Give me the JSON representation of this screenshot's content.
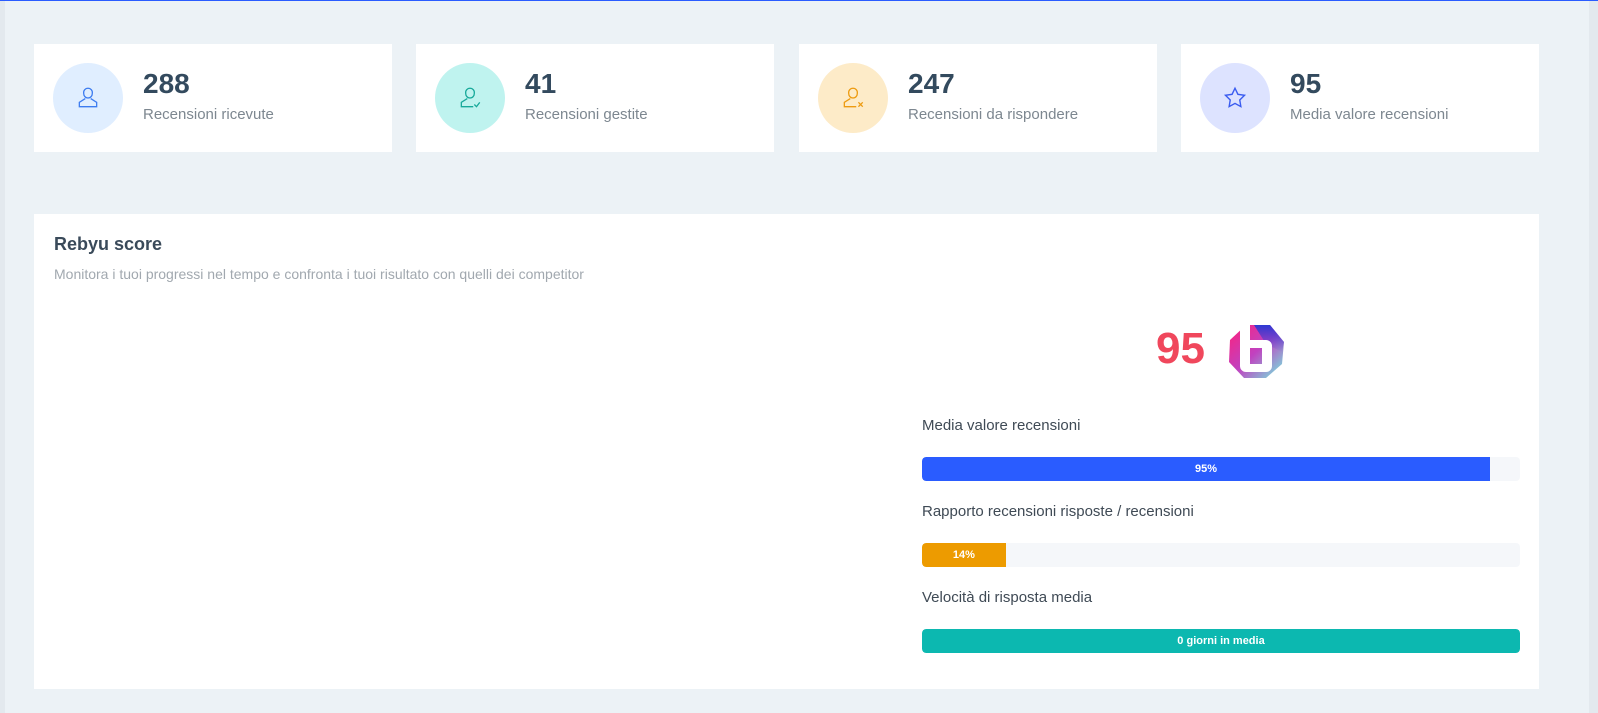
{
  "stats": [
    {
      "value": "288",
      "label": "Recensioni ricevute",
      "icon": "user-icon",
      "bg": "#e0eeff",
      "color": "#3d7cf0"
    },
    {
      "value": "41",
      "label": "Recensioni gestite",
      "icon": "user-check-icon",
      "bg": "#bff3ef",
      "color": "#17a99a"
    },
    {
      "value": "247",
      "label": "Recensioni da rispondere",
      "icon": "user-x-icon",
      "bg": "#fdebc8",
      "color": "#ed9b11"
    },
    {
      "value": "95",
      "label": "Media valore recensioni",
      "icon": "star-icon",
      "bg": "#dde3ff",
      "color": "#3a5cf0"
    }
  ],
  "panel": {
    "title": "Rebyu score",
    "subtitle": "Monitora i tuoi progressi nel tempo e confronta i tuoi risultato con quelli dei competitor",
    "score": "95"
  },
  "metrics": [
    {
      "label": "Media valore recensioni",
      "bar_text": "95%",
      "percent": 95,
      "color": "#2a5cff"
    },
    {
      "label": "Rapporto recensioni risposte / recensioni",
      "bar_text": "14%",
      "percent": 14,
      "color": "#ed9b00"
    },
    {
      "label": "Velocità di risposta media",
      "bar_text": "0 giorni in media",
      "percent": 100,
      "color": "#0cb8b0"
    }
  ]
}
